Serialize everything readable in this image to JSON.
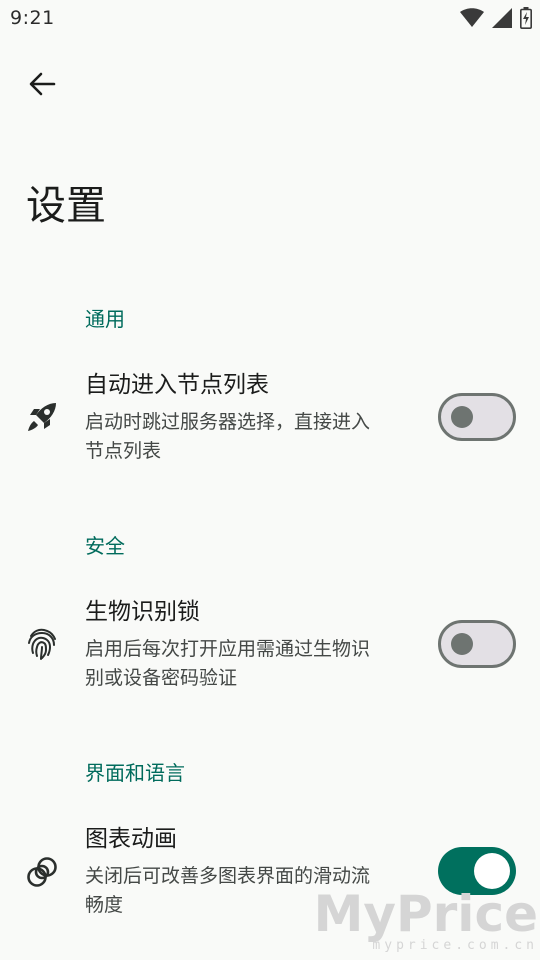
{
  "status_bar": {
    "time": "9:21",
    "icons": [
      "wifi-icon",
      "signal-icon",
      "battery-icon"
    ]
  },
  "header": {
    "back_icon": "arrow-back-icon",
    "title": "设置"
  },
  "sections": [
    {
      "header": "通用",
      "items": [
        {
          "icon": "rocket-icon",
          "title": "自动进入节点列表",
          "description_lines": [
            "启动时跳过服务器选择，直接进入",
            "节点列表"
          ],
          "enabled": false
        }
      ]
    },
    {
      "header": "安全",
      "items": [
        {
          "icon": "fingerprint-icon",
          "title": "生物识别锁",
          "description_lines": [
            "启用后每次打开应用需通过生物识",
            "别或设备密码验证"
          ],
          "enabled": false
        }
      ]
    },
    {
      "header": "界面和语言",
      "items": [
        {
          "icon": "chart-animation-icon",
          "title": "图表动画",
          "description_lines": [
            "关闭后可改善多图表界面的滑动流",
            "畅度"
          ],
          "enabled": true
        }
      ]
    }
  ],
  "watermark": {
    "logo": "MyPrice",
    "url": "myprice.com.cn"
  },
  "colors": {
    "background": "#f9faf8",
    "accent": "#006b5c",
    "toggle_on": "#00705e",
    "toggle_off_track": "#e3e0e5",
    "toggle_off_outline": "#6e7471"
  }
}
